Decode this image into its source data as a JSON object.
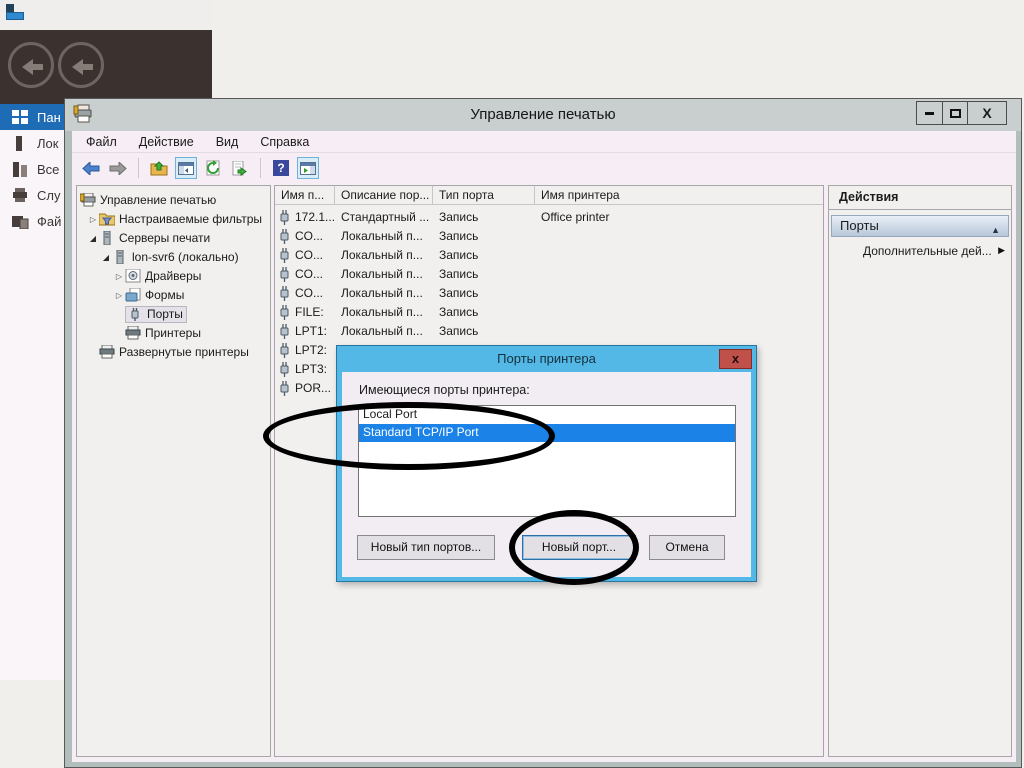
{
  "server_manager": {
    "nav_items": [
      {
        "label": "Пан",
        "selected": true
      },
      {
        "label": "Лок",
        "selected": false
      },
      {
        "label": "Все",
        "selected": false
      },
      {
        "label": "Слу",
        "selected": false
      },
      {
        "label": "Фай",
        "selected": false
      }
    ]
  },
  "window": {
    "title": "Управление печатью",
    "menu": [
      "Файл",
      "Действие",
      "Вид",
      "Справка"
    ],
    "controls": {
      "close": "X"
    },
    "toolbar": {
      "help_glyph": "?"
    }
  },
  "tree": {
    "items": [
      {
        "label": "Управление печатью",
        "expander": "",
        "selected": false
      },
      {
        "label": "Настраиваемые фильтры",
        "expander": "▷",
        "selected": false
      },
      {
        "label": "Серверы печати",
        "expander": "◢",
        "selected": false
      },
      {
        "label": "lon-svr6 (локально)",
        "expander": "◢",
        "selected": false
      },
      {
        "label": "Драйверы",
        "expander": "▷",
        "selected": false
      },
      {
        "label": "Формы",
        "expander": "▷",
        "selected": false
      },
      {
        "label": "Порты",
        "expander": "",
        "selected": true
      },
      {
        "label": "Принтеры",
        "expander": "",
        "selected": false
      },
      {
        "label": "Развернутые принтеры",
        "expander": "",
        "selected": false
      }
    ]
  },
  "list": {
    "columns": [
      "Имя п...",
      "Описание пор...",
      "Тип порта",
      "Имя принтера"
    ],
    "rows": [
      {
        "name": "172.1...",
        "desc": "Стандартный ...",
        "type": "Запись",
        "printer": "Office printer"
      },
      {
        "name": "CO...",
        "desc": "Локальный п...",
        "type": "Запись",
        "printer": ""
      },
      {
        "name": "CO...",
        "desc": "Локальный п...",
        "type": "Запись",
        "printer": ""
      },
      {
        "name": "CO...",
        "desc": "Локальный п...",
        "type": "Запись",
        "printer": ""
      },
      {
        "name": "CO...",
        "desc": "Локальный п...",
        "type": "Запись",
        "printer": ""
      },
      {
        "name": "FILE:",
        "desc": "Локальный п...",
        "type": "Запись",
        "printer": ""
      },
      {
        "name": "LPT1:",
        "desc": "Локальный п...",
        "type": "Запись",
        "printer": ""
      },
      {
        "name": "LPT2:",
        "desc": "",
        "type": "",
        "printer": ""
      },
      {
        "name": "LPT3:",
        "desc": "",
        "type": "",
        "printer": ""
      },
      {
        "name": "POR...",
        "desc": "",
        "type": "",
        "printer": ""
      }
    ]
  },
  "actions": {
    "header": "Действия",
    "section": "Порты",
    "collapse_glyph": "▲",
    "item": "Дополнительные дей...",
    "item_arrow": "▶"
  },
  "dialog": {
    "title": "Порты принтера",
    "close_glyph": "x",
    "label": "Имеющиеся порты принтера:",
    "ports": [
      {
        "name": "Local Port",
        "selected": false
      },
      {
        "name": "Standard TCP/IP Port",
        "selected": true
      }
    ],
    "buttons": {
      "new_type": "Новый тип портов...",
      "new_port": "Новый порт...",
      "cancel": "Отмена"
    }
  },
  "colors": {
    "dialog_accent": "#54b8e6",
    "selection_blue": "#1b83e8",
    "close_red": "#c0504a",
    "nav_selected_blue": "#1e6cb5"
  }
}
